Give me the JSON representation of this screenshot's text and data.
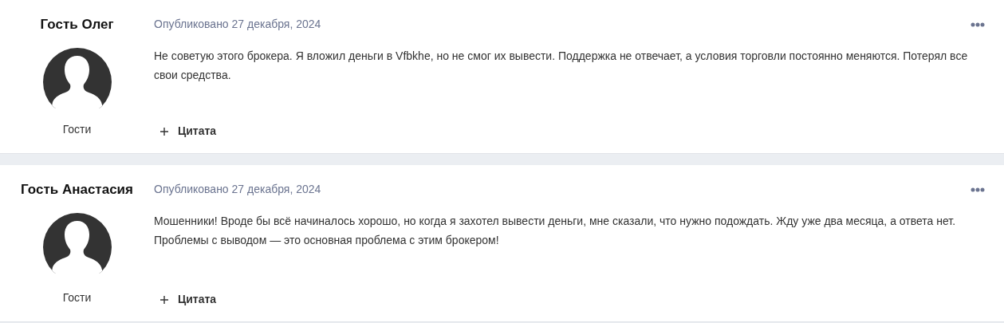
{
  "posts": [
    {
      "author": "Гость Олег",
      "group": "Гости",
      "published": "Опубликовано 27 декабря, 2024",
      "text": "Не советую этого брокера. Я вложил деньги в Vfbkhe, но не смог их вывести. Поддержка не отвечает, а условия торговли постоянно меняются. Потерял все свои средства.",
      "quote_button": "Цитата"
    },
    {
      "author": "Гость Анастасия",
      "group": "Гости",
      "published": "Опубликовано 27 декабря, 2024",
      "text": "Мошенники! Вроде бы всё начиналось хорошо, но когда я захотел вывести деньги, мне сказали, что нужно подождать. Жду уже два месяца, а ответа нет. Проблемы с выводом — это основная проблема с этим брокером!",
      "quote_button": "Цитата"
    }
  ]
}
